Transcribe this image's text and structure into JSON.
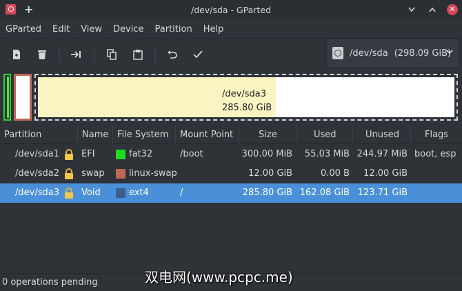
{
  "window": {
    "title": "/dev/sda - GParted"
  },
  "menu": [
    "GParted",
    "Edit",
    "View",
    "Device",
    "Partition",
    "Help"
  ],
  "toolbar": {
    "tools": [
      "new-icon",
      "delete-icon",
      "resize-move-icon",
      "copy-icon",
      "paste-icon",
      "undo-icon",
      "apply-icon"
    ]
  },
  "device": {
    "name": "/dev/sda",
    "size": "(298.09 GiB)"
  },
  "disk_map": {
    "label_name": "/dev/sda3",
    "label_size": "285.80 GiB"
  },
  "table": {
    "headers": [
      "Partition",
      "Name",
      "File System",
      "Mount Point",
      "Size",
      "Used",
      "Unused",
      "Flags"
    ],
    "rows": [
      {
        "partition": "/dev/sda1",
        "name": "EFI",
        "fs": "fat32",
        "fs_color": "#1fdc1f",
        "mount": "/boot",
        "size": "300.00 MiB",
        "used": "55.03 MiB",
        "unused": "244.97 MiB",
        "flags": "boot, esp"
      },
      {
        "partition": "/dev/sda2",
        "name": "swap",
        "fs": "linux-swap",
        "fs_color": "#c0675a",
        "mount": "",
        "size": "12.00 GiB",
        "used": "0.00 B",
        "unused": "12.00 GiB",
        "flags": ""
      },
      {
        "partition": "/dev/sda3",
        "name": "Void",
        "fs": "ext4",
        "fs_color": "#3a5f8a",
        "mount": "/",
        "size": "285.80 GiB",
        "used": "162.08 GiB",
        "unused": "123.71 GiB",
        "flags": ""
      }
    ]
  },
  "status": {
    "text": "0 operations pending"
  },
  "watermark": "双电网(www.pcpc.me)",
  "colors": {
    "selection": "#4a90d9",
    "background": "#2f3237"
  }
}
